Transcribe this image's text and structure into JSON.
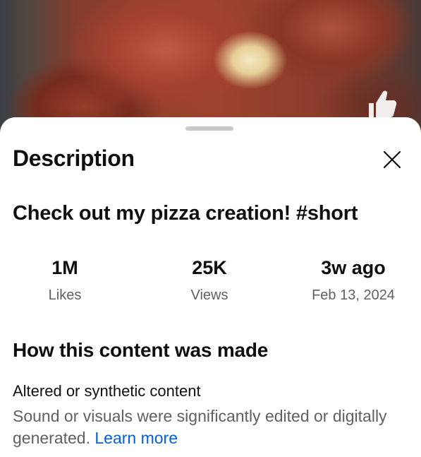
{
  "sheet": {
    "title": "Description",
    "close_icon": "close-icon"
  },
  "video": {
    "title": "Check out my pizza creation! #short",
    "like_icon": "thumbs-up-icon"
  },
  "stats": [
    {
      "value": "1M",
      "label": "Likes"
    },
    {
      "value": "25K",
      "label": "Views"
    },
    {
      "value": "3w ago",
      "label": "Feb 13, 2024"
    }
  ],
  "made": {
    "heading": "How this content was made",
    "subheading": "Altered or synthetic content",
    "description": "Sound or visuals were significantly edited or digitally generated.",
    "learn_more": "Learn more"
  },
  "colors": {
    "link": "#065fd4",
    "secondary_text": "#606060",
    "primary_text": "#0f0f0f"
  }
}
